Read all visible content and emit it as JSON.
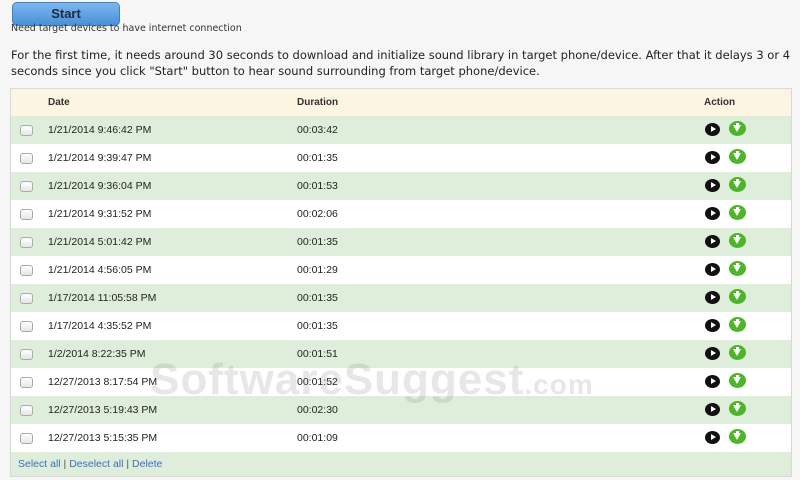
{
  "start_label": "Start",
  "note": "Need target devices to have internet connection",
  "description": "For the first time, it needs around 30 seconds to download and initialize sound library in target phone/device. After that it delays 3 or 4 seconds since you click \"Start\" button to hear sound surrounding from target phone/device.",
  "table": {
    "headers": {
      "date": "Date",
      "duration": "Duration",
      "action": "Action"
    },
    "rows": [
      {
        "date": "1/21/2014 9:46:42 PM",
        "duration": "00:03:42"
      },
      {
        "date": "1/21/2014 9:39:47 PM",
        "duration": "00:01:35"
      },
      {
        "date": "1/21/2014 9:36:04 PM",
        "duration": "00:01:53"
      },
      {
        "date": "1/21/2014 9:31:52 PM",
        "duration": "00:02:06"
      },
      {
        "date": "1/21/2014 5:01:42 PM",
        "duration": "00:01:35"
      },
      {
        "date": "1/21/2014 4:56:05 PM",
        "duration": "00:01:29"
      },
      {
        "date": "1/17/2014 11:05:58 PM",
        "duration": "00:01:35"
      },
      {
        "date": "1/17/2014 4:35:52 PM",
        "duration": "00:01:35"
      },
      {
        "date": "1/2/2014 8:22:35 PM",
        "duration": "00:01:51"
      },
      {
        "date": "12/27/2013 8:17:54 PM",
        "duration": "00:01:52"
      },
      {
        "date": "12/27/2013 5:19:43 PM",
        "duration": "00:02:30"
      },
      {
        "date": "12/27/2013 5:15:35 PM",
        "duration": "00:01:09"
      }
    ]
  },
  "footer": {
    "select_all": "Select all",
    "deselect_all": "Deselect all",
    "delete": "Delete",
    "separator": "|"
  },
  "watermark": {
    "main": "SoftwareSuggest",
    "suffix": ".com"
  }
}
